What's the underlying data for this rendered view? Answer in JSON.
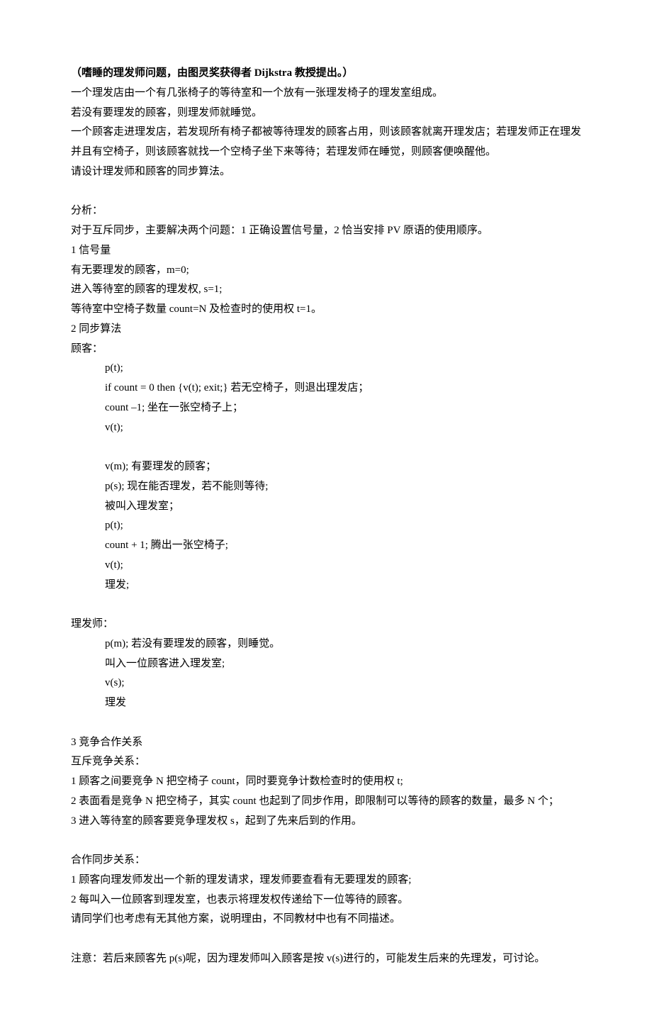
{
  "title": "（嗜睡的理发师问题，由图灵奖获得者 Dijkstra 教授提出。）",
  "intro": [
    "一个理发店由一个有几张椅子的等待室和一个放有一张理发椅子的理发室组成。",
    "若没有要理发的顾客，则理发师就睡觉。",
    "一个顾客走进理发店，若发现所有椅子都被等待理发的顾客占用，则该顾客就离开理发店；若理发师正在理发并且有空椅子，则该顾客就找一个空椅子坐下来等待；若理发师在睡觉，则顾客便唤醒他。",
    "请设计理发师和顾客的同步算法。"
  ],
  "analysis_h": "分析：",
  "analysis_p": "对于互斥同步，主要解决两个问题：1 正确设置信号量，2 恰当安排 PV 原语的使用顺序。",
  "sec1_h": "1 信号量",
  "sec1": [
    "有无要理发的顾客，m=0;",
    "进入等待室的顾客的理发权, s=1;",
    "等待室中空椅子数量 count=N 及检查时的使用权 t=1。"
  ],
  "sec2_h": "2 同步算法",
  "customer_h": "顾客：",
  "customer_code1": [
    "p(t);",
    "if count = 0 then {v(t); exit;}     若无空椅子，则退出理发店；",
    "count –1;    坐在一张空椅子上；",
    "v(t);"
  ],
  "customer_code2": [
    "v(m);           有要理发的顾客；",
    "p(s);             现在能否理发，若不能则等待;",
    "被叫入理发室；",
    "p(t);",
    "count + 1;     腾出一张空椅子;",
    "v(t);",
    "理发;"
  ],
  "barber_h": "理发师：",
  "barber_code": [
    "p(m);   若没有要理发的顾客，则睡觉。",
    "叫入一位顾客进入理发室;",
    "v(s);",
    "理发"
  ],
  "sec3_h": "3 竞争合作关系",
  "compete_h": "互斥竞争关系：",
  "compete": [
    "1 顾客之间要竞争 N 把空椅子 count，同时要竞争计数检查时的使用权 t;",
    "2 表面看是竞争 N 把空椅子，其实 count 也起到了同步作用，即限制可以等待的顾客的数量，最多 N 个；",
    "3 进入等待室的顾客要竞争理发权 s，起到了先来后到的作用。"
  ],
  "coop_h": "合作同步关系：",
  "coop": [
    "1 顾客向理发师发出一个新的理发请求，理发师要查看有无要理发的顾客;",
    "2 每叫入一位顾客到理发室，也表示将理发权传递给下一位等待的顾客。",
    "请同学们也考虑有无其他方案，说明理由，不同教材中也有不同描述。"
  ],
  "note": "注意：若后来顾客先 p(s)呢，因为理发师叫入顾客是按 v(s)进行的，可能发生后来的先理发，可讨论。"
}
